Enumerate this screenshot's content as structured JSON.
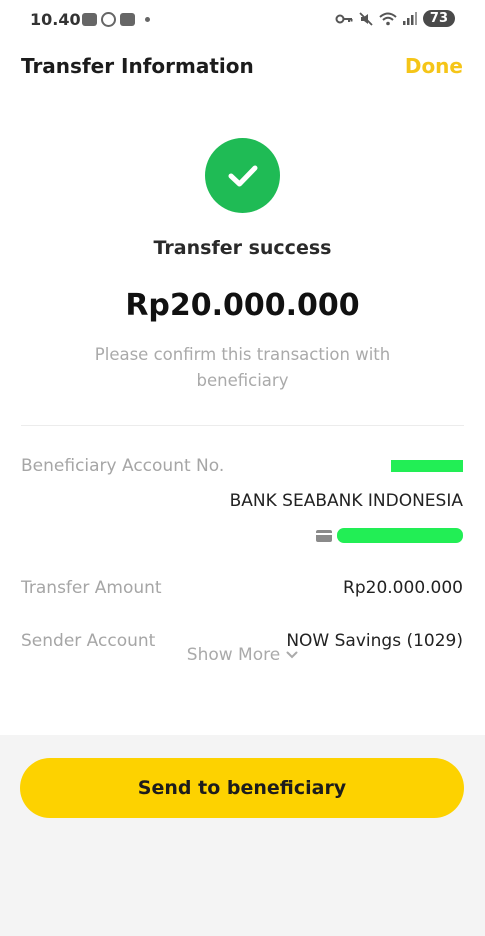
{
  "status_bar": {
    "time": "10.40",
    "battery": "73"
  },
  "header": {
    "title": "Transfer Information",
    "done_label": "Done"
  },
  "result": {
    "status_text": "Transfer success",
    "amount": "Rp20.000.000",
    "note": "Please confirm this transaction with beneficiary"
  },
  "details": {
    "beneficiary_label": "Beneficiary Account No.",
    "beneficiary_bank": "BANK SEABANK INDONESIA",
    "transfer_amount_label": "Transfer Amount",
    "transfer_amount_value": "Rp20.000.000",
    "sender_label": "Sender Account",
    "sender_value": "NOW Savings (1029)"
  },
  "show_more_label": "Show More",
  "send_button_label": "Send to beneficiary",
  "colors": {
    "accent_yellow": "#fdd200",
    "done_text": "#f5c518",
    "success_green": "#1fbb55",
    "redaction_green": "#22ee55"
  },
  "icons": [
    "checkmark-icon",
    "chevron-down-icon",
    "card-icon",
    "wifi-icon",
    "signal-icon",
    "key-icon",
    "mute-icon",
    "whatsapp-icon"
  ]
}
